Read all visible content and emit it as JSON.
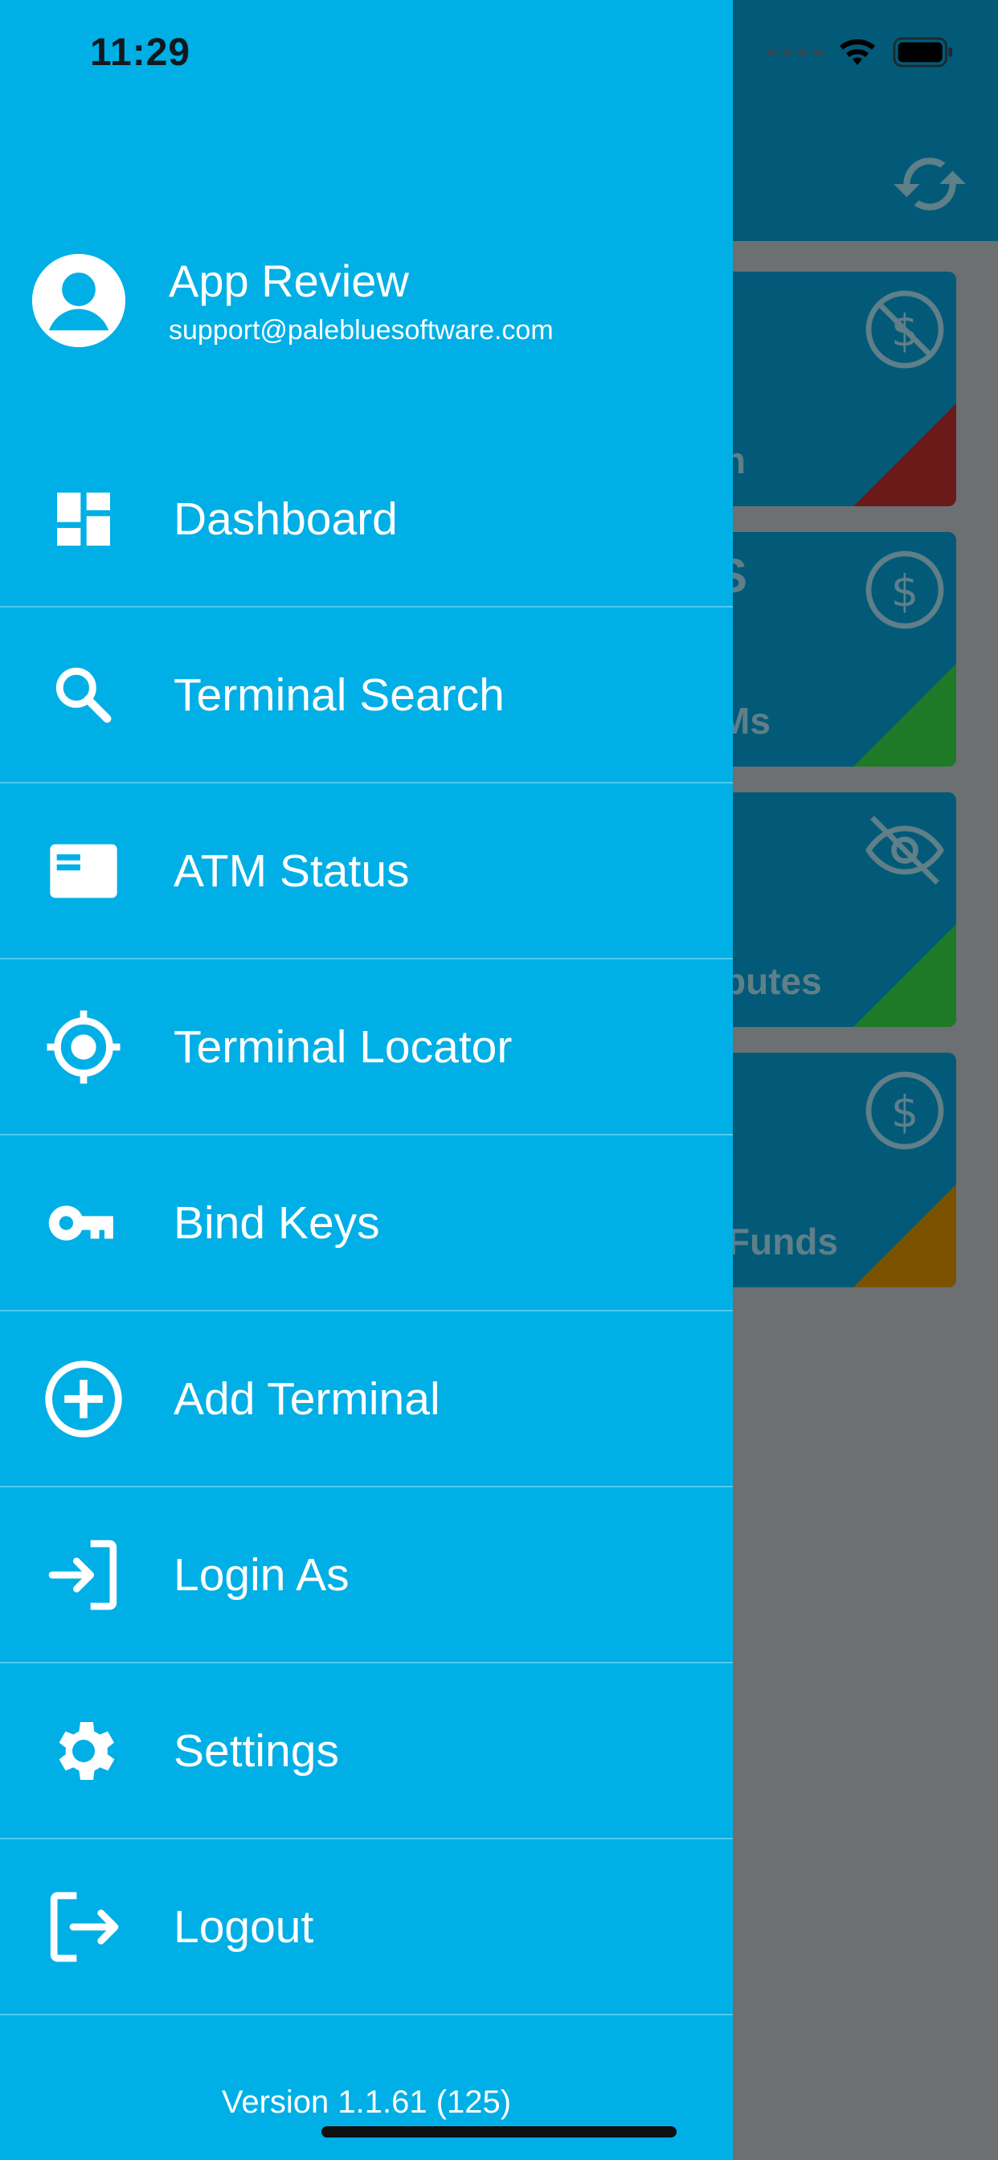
{
  "status_bar": {
    "time": "11:29"
  },
  "profile": {
    "name": "App Review",
    "email": "support@palebluesoftware.com"
  },
  "menu": [
    {
      "label": "Dashboard",
      "icon": "dashboard-icon"
    },
    {
      "label": "Terminal Search",
      "icon": "search-icon"
    },
    {
      "label": "ATM Status",
      "icon": "card-icon"
    },
    {
      "label": "Terminal Locator",
      "icon": "crosshair-icon"
    },
    {
      "label": "Bind Keys",
      "icon": "key-icon"
    },
    {
      "label": "Add Terminal",
      "icon": "plus-circle-icon"
    },
    {
      "label": "Login As",
      "icon": "login-icon"
    },
    {
      "label": "Settings",
      "icon": "gear-icon"
    },
    {
      "label": "Logout",
      "icon": "logout-icon"
    }
  ],
  "version": "Version 1.1.61 (125)",
  "background_cards": [
    {
      "label": "n",
      "icon": "no-money-icon",
      "accent": "#6b1a1a"
    },
    {
      "label": "Ms",
      "top": "S",
      "icon": "dollar-icon",
      "accent": "#1e7a26"
    },
    {
      "label": "butes",
      "icon": "eye-off-icon",
      "accent": "#1e7a26"
    },
    {
      "label": "Funds",
      "icon": "dollar-icon",
      "accent": "#7a5200"
    }
  ],
  "colors": {
    "drawer": "#00afe6",
    "header": "#025a78",
    "overlay": "#6c7072"
  }
}
